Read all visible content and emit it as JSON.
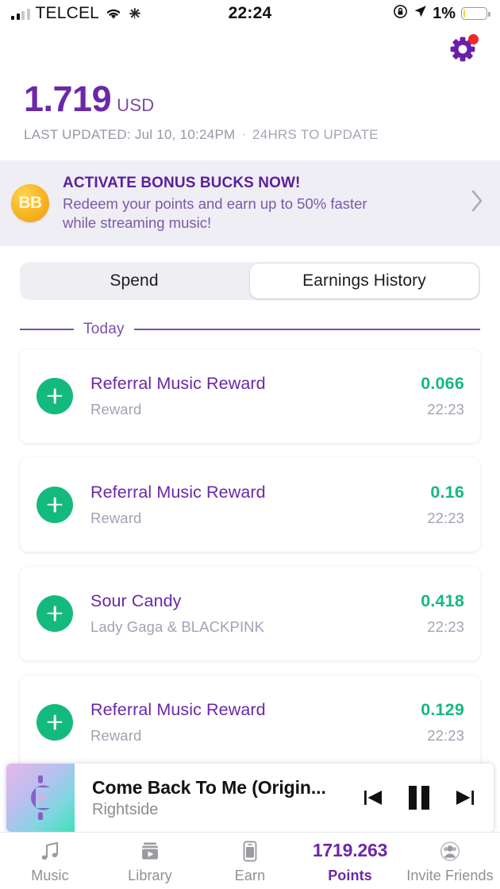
{
  "status_bar": {
    "carrier": "TELCEL",
    "time": "22:24",
    "battery_percent": "1%",
    "icons": [
      "signal-bars-icon",
      "wifi-icon",
      "spinner-icon",
      "rotation-lock-icon",
      "location-arrow-icon",
      "battery-icon"
    ]
  },
  "header": {
    "settings_icon": "gear-icon",
    "settings_badge": true
  },
  "balance": {
    "amount": "1.719",
    "currency": "USD",
    "last_updated": "LAST UPDATED: Jul 10, 10:24PM",
    "separator": "·",
    "update_note": "24HRS TO UPDATE"
  },
  "banner": {
    "badge": "BB",
    "title": "ACTIVATE BONUS BUCKS NOW!",
    "body": "Redeem your points and earn up to 50% faster while streaming music!",
    "chevron": "chevron-right-icon"
  },
  "tabs": {
    "items": [
      {
        "label": "Spend",
        "active": false
      },
      {
        "label": "Earnings History",
        "active": true
      }
    ]
  },
  "section": {
    "label": "Today"
  },
  "transactions": [
    {
      "title": "Referral Music Reward",
      "subtitle": "Reward",
      "amount": "0.066",
      "time": "22:23",
      "icon": "plus-icon"
    },
    {
      "title": "Referral Music Reward",
      "subtitle": "Reward",
      "amount": "0.16",
      "time": "22:23",
      "icon": "plus-icon"
    },
    {
      "title": "Sour Candy",
      "subtitle": "Lady Gaga & BLACKPINK",
      "amount": "0.418",
      "time": "22:23",
      "icon": "plus-icon"
    },
    {
      "title": "Referral Music Reward",
      "subtitle": "Reward",
      "amount": "0.129",
      "time": "22:23",
      "icon": "plus-icon"
    }
  ],
  "player": {
    "artwork_icon": "dollar-play-logo-icon",
    "title": "Come Back To Me (Origin...",
    "artist": "Rightside",
    "controls": [
      {
        "name": "previous-track-button",
        "icon": "skip-back-icon"
      },
      {
        "name": "pause-button",
        "icon": "pause-icon"
      },
      {
        "name": "next-track-button",
        "icon": "skip-forward-icon"
      }
    ]
  },
  "bottom_nav": [
    {
      "label": "Music",
      "icon": "music-note-icon",
      "active": false
    },
    {
      "label": "Library",
      "icon": "library-play-icon",
      "active": false
    },
    {
      "label": "Earn",
      "icon": "phone-device-icon",
      "active": false
    },
    {
      "label": "Points",
      "icon": "points-value",
      "value": "1719.263",
      "active": true
    },
    {
      "label": "Invite Friends",
      "icon": "user-circle-icon",
      "active": false
    }
  ],
  "colors": {
    "brand_purple": "#6b28a8",
    "accent_green": "#14b97e",
    "banner_bg": "#efeef5",
    "muted": "#a79fb3",
    "badge_red": "#ee2a24"
  }
}
